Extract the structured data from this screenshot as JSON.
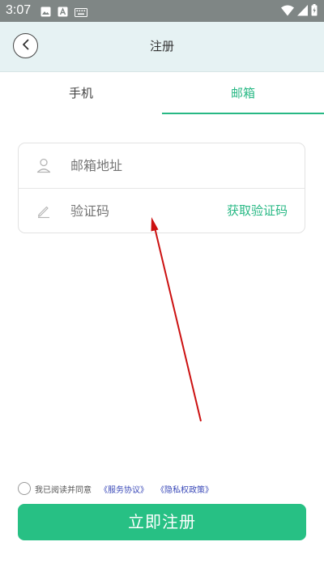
{
  "status_bar": {
    "time": "3:07",
    "icons_left": [
      "image-icon",
      "a-icon",
      "keyboard-icon"
    ],
    "icons_right": [
      "wifi-icon",
      "signal-icon",
      "battery-icon"
    ]
  },
  "header": {
    "title": "注册",
    "back_icon": "chevron-left-icon",
    "background": "#e6f2f3"
  },
  "tabs": {
    "items": [
      {
        "label": "手机",
        "active": false
      },
      {
        "label": "邮箱",
        "active": true
      }
    ],
    "active_color": "#27b884"
  },
  "form": {
    "email": {
      "placeholder": "邮箱地址",
      "icon": "person-icon"
    },
    "code": {
      "placeholder": "验证码",
      "icon": "pencil-icon",
      "get_code_label": "获取验证码"
    }
  },
  "agreement": {
    "text": "我已阅读并同意",
    "service_link": "《服务协议》",
    "privacy_link": "《隐私权政策》",
    "checked": false
  },
  "register_button": {
    "label": "立即注册",
    "color": "#27c084"
  },
  "annotation": {
    "type": "red-arrow",
    "color": "#cc1111"
  }
}
